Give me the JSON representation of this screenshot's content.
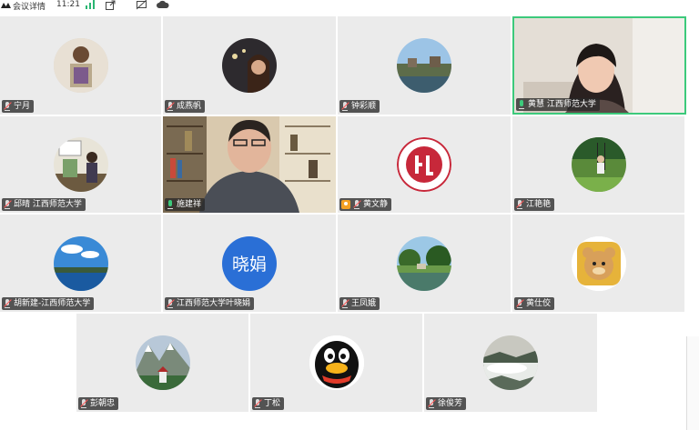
{
  "topbar": {
    "title": "会议详情",
    "time": "11:21"
  },
  "participants": [
    {
      "name": "宁月"
    },
    {
      "name": "成燕帆"
    },
    {
      "name": "钟彩顺"
    },
    {
      "name": "黄慧 江西师范大学"
    },
    {
      "name": "邱晴 江西师范大学"
    },
    {
      "name": "施建祥"
    },
    {
      "name": "黄文静"
    },
    {
      "name": "江艳艳"
    },
    {
      "name": "胡新建-江西师范大学"
    },
    {
      "name": "江西师范大学叶晓娟",
      "avatar_text": "晓娟"
    },
    {
      "name": "王凤娥"
    },
    {
      "name": "黄仕佼"
    },
    {
      "name": "彭朝忠"
    },
    {
      "name": "丁松"
    },
    {
      "name": "徐俊芳"
    }
  ],
  "colors": {
    "active_speaker_border": "#3cc97b",
    "avatar_blue": "#2a6fd6"
  }
}
